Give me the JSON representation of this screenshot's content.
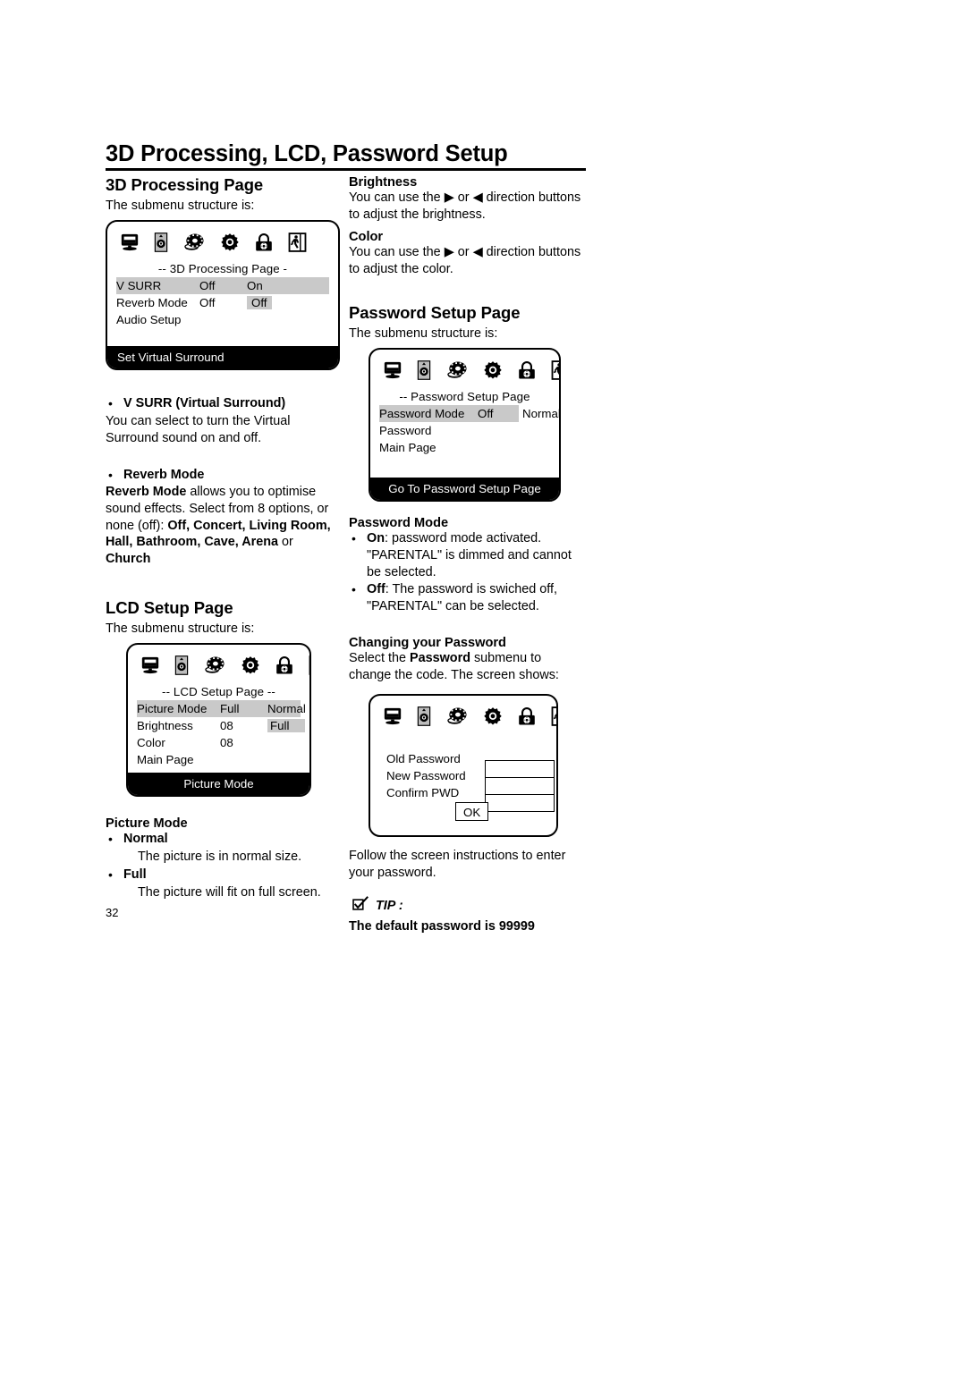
{
  "chapter_title": "3D Processing, LCD, Password Setup",
  "page_number": "32",
  "icons": [
    "monitor-icon",
    "speaker-icon",
    "disc-icon",
    "gear-icon",
    "lock-icon",
    "exit-icon"
  ],
  "left_column": {
    "s1_title": "3D Processing Page",
    "s1_lead": "The submenu structure is:",
    "osd_3d": {
      "heading": "--  3D Processing Page  -",
      "rows": [
        {
          "label": "V SURR",
          "value": "Off",
          "right": "On",
          "row_highlight": true,
          "right_highlight": false
        },
        {
          "label": "Reverb Mode",
          "value": "Off",
          "right": "Off",
          "row_highlight": false,
          "right_highlight": true
        },
        {
          "label": "Audio Setup",
          "value": "",
          "right": "",
          "row_highlight": false,
          "right_highlight": false
        }
      ],
      "footer": "Set Virtual Surround"
    },
    "b1_bullet": "V SURR (Virtual Surround)",
    "b1_text": "You can select to turn the Virtual Surround sound on and off.",
    "b2_bullet": "Reverb Mode",
    "b2_text_bold1": "Reverb Mode",
    "b2_text_mid": " allows you to optimise sound effects. Select from 8 options, or none (off): ",
    "b2_text_bold2": "Off, Concert, Living Room, Hall, Bathroom, Cave, Arena",
    "b2_text_or": " or ",
    "b2_text_bold3": "Church",
    "s2_title": "LCD Setup Page",
    "s2_lead": "The submenu structure is:",
    "osd_lcd": {
      "heading": "--  LCD Setup Page  --",
      "rows": [
        {
          "label": "Picture Mode",
          "value": "Full",
          "right": "Normal",
          "row_highlight": true,
          "right_highlight": false
        },
        {
          "label": "Brightness",
          "value": "08",
          "right": "Full",
          "row_highlight": false,
          "right_highlight": true
        },
        {
          "label": "Color",
          "value": "08",
          "right": "",
          "row_highlight": false,
          "right_highlight": false
        },
        {
          "label": "Main Page",
          "value": "",
          "right": "",
          "row_highlight": false,
          "right_highlight": false
        }
      ],
      "footer": "Picture Mode"
    },
    "pm_title": "Picture Mode",
    "pm_b1": "Normal",
    "pm_b1_text": "The picture is in normal size.",
    "pm_b2": "Full",
    "pm_b2_text": "The picture will fit on full screen."
  },
  "right_column": {
    "bright_title": "Brightness",
    "bright_text_a": "You can use the ",
    "bright_text_b": " or ",
    "bright_text_c": " direction buttons to adjust the brightness.",
    "color_title": "Color",
    "color_text_c": " direction buttons to adjust the color.",
    "arrow_right": "▶",
    "arrow_left": "◀",
    "s3_title": "Password Setup Page",
    "s3_lead": "The submenu structure is:",
    "osd_pwd": {
      "heading": "--  Password Setup Page",
      "rows": [
        {
          "label": "Password Mode",
          "value": "Off",
          "right": "Normal",
          "row_highlight": true,
          "right_highlight": false
        },
        {
          "label": "Password",
          "value": "",
          "right": "",
          "row_highlight": false,
          "right_highlight": false
        },
        {
          "label": "Main Page",
          "value": "",
          "right": "",
          "row_highlight": false,
          "right_highlight": false
        }
      ],
      "footer": "Go To Password Setup Page"
    },
    "pwmode_title": "Password Mode",
    "pwmode_b1_bold": "On",
    "pwmode_b1_text": ": password mode activated. \"PARENTAL\" is dimmed and cannot be selected.",
    "pwmode_b2_bold": "Off",
    "pwmode_b2_text": ": The  password is swiched off, \"PARENTAL\" can be selected.",
    "change_title": "Changing your Password",
    "change_text_a": "Select the ",
    "change_text_bold": "Password",
    "change_text_b": " submenu to change the code. The screen shows:",
    "osd_entry": {
      "labels": [
        "Old Password",
        "New Password",
        "Confirm PWD"
      ],
      "field_values": [
        "",
        "",
        ""
      ],
      "ok_label": "OK"
    },
    "follow_text": "Follow the screen instructions to enter your password.",
    "tip_label": "TIP :",
    "tip_icon": "check-box-icon",
    "tip_text": "The default password is 99999"
  },
  "colors": {
    "ink": "#000000",
    "highlight_gray": "#c9c9c9",
    "footer_bar": "#000000",
    "paper": "#ffffff"
  }
}
